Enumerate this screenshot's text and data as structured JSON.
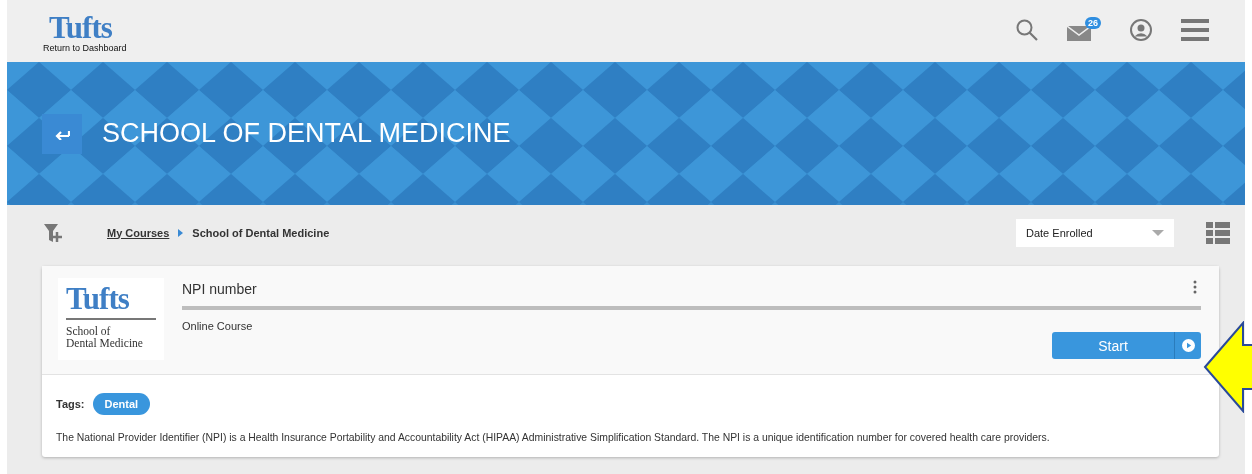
{
  "header": {
    "logo": "Tufts",
    "return_link": "Return to Dashboard",
    "messages_badge": "26"
  },
  "banner": {
    "title": "SCHOOL OF DENTAL MEDICINE"
  },
  "toolbar": {
    "breadcrumb": [
      "My Courses",
      "School of Dental Medicine"
    ],
    "sort": {
      "value": "Date Enrolled"
    }
  },
  "course": {
    "logo": {
      "wordmark": "Tufts",
      "subtitle_lines": [
        "School of",
        "Dental Medicine"
      ]
    },
    "title": "NPI number",
    "type": "Online Course",
    "action": "Start",
    "tags_label": "Tags:",
    "tags": [
      "Dental"
    ],
    "description": "The National Provider Identifier (NPI) is a Health Insurance Portability and Accountability Act (HIPAA) Administrative Simplification Standard. The NPI is a unique identification number for covered health care providers."
  }
}
